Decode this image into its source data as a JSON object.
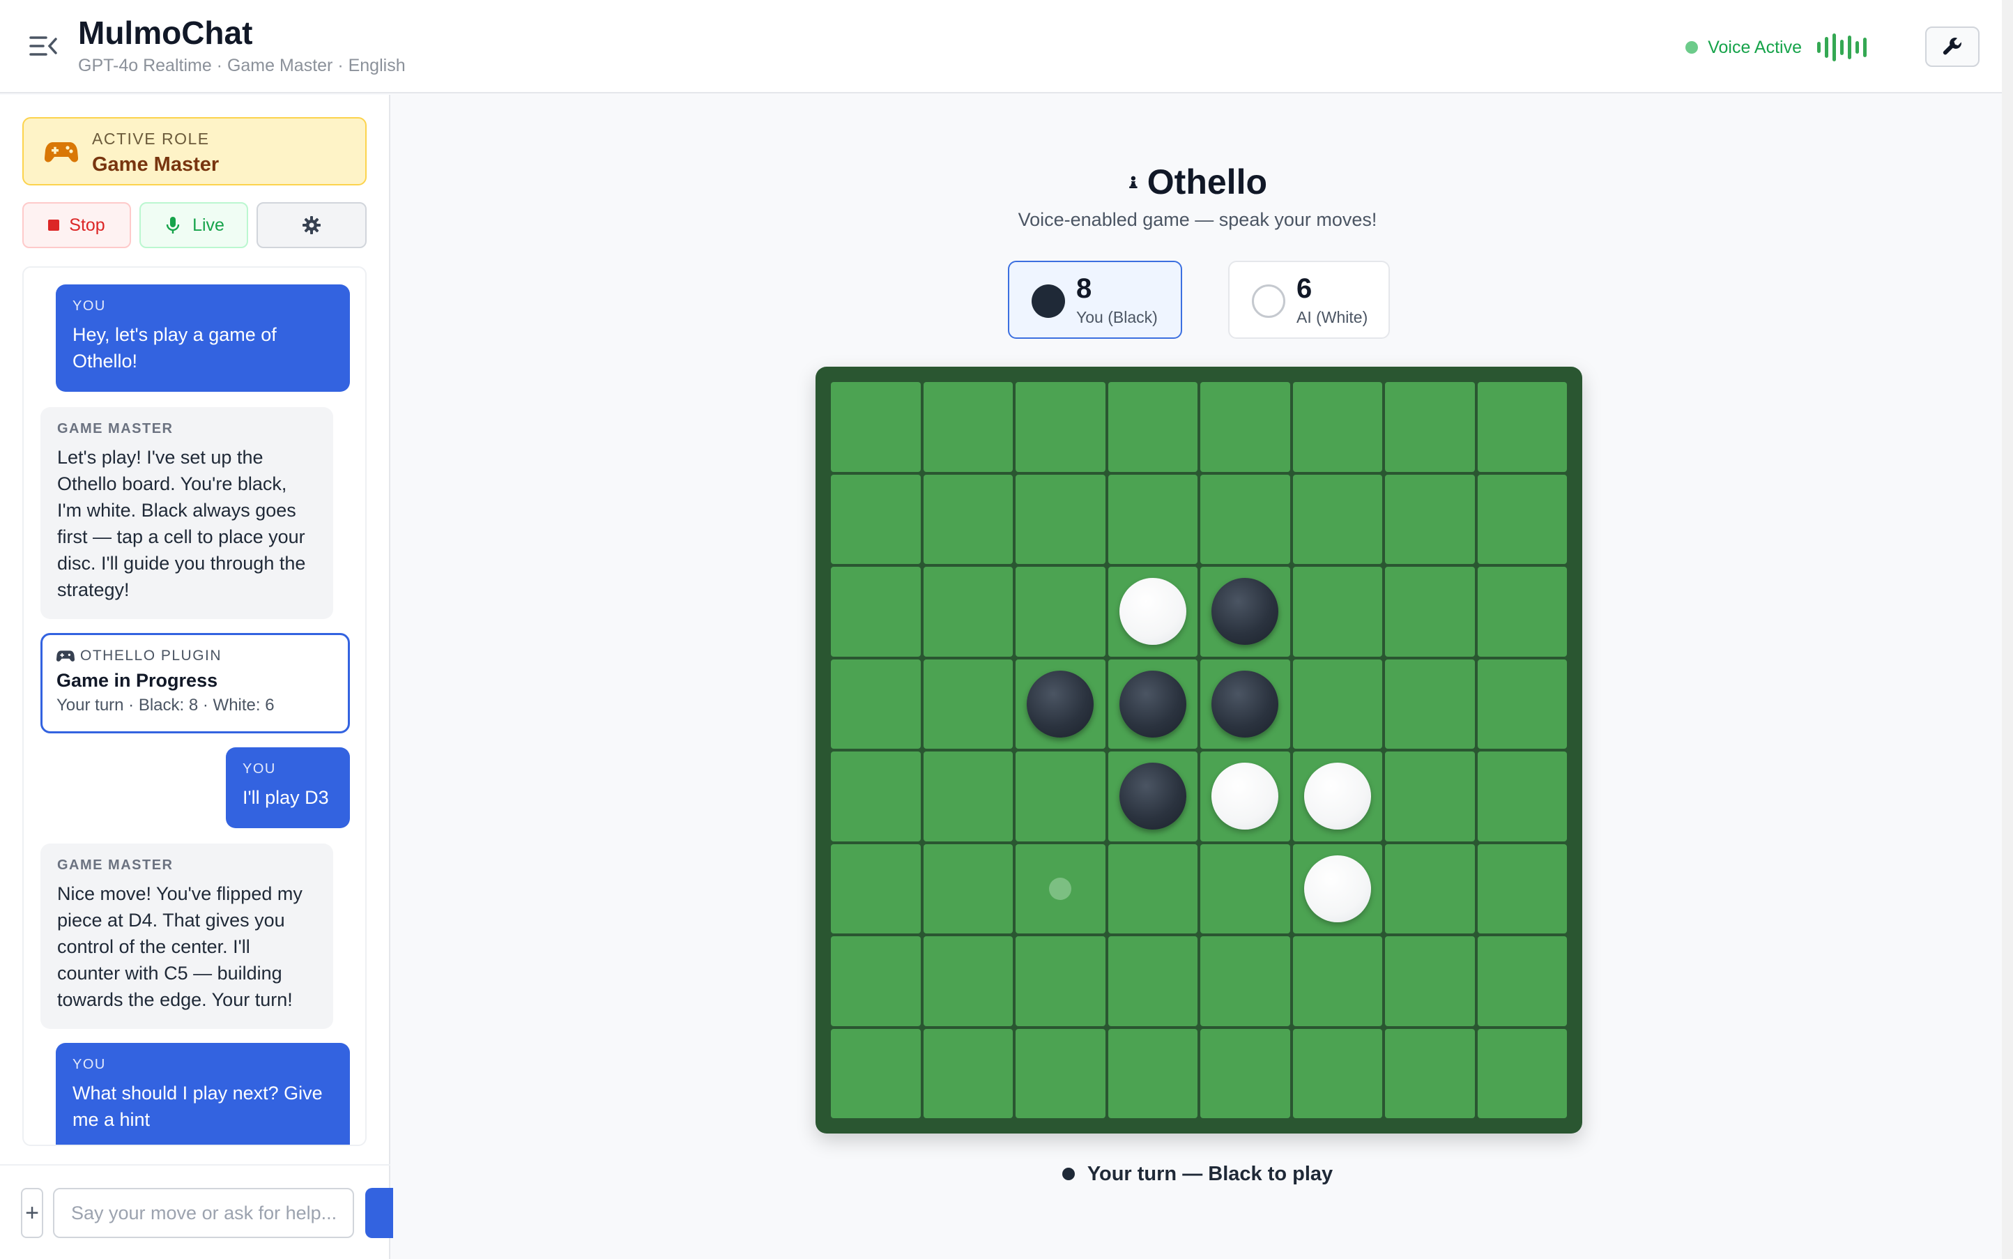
{
  "header": {
    "title": "MulmoChat",
    "subtitle": "GPT-4o Realtime · Game Master · English",
    "voice_status": "Voice Active"
  },
  "sidebar": {
    "role_label": "ACTIVE ROLE",
    "role_name": "Game Master",
    "stop_label": "Stop",
    "live_label": "Live",
    "messages": [
      {
        "role": "user",
        "who": "YOU",
        "text": "Hey, let's play a game of Othello!"
      },
      {
        "role": "assistant",
        "who": "GAME MASTER",
        "text": "Let's play! I've set up the Othello board. You're black, I'm white. Black always goes first — tap a cell to place your disc. I'll guide you through the strategy!"
      },
      {
        "role": "plugin",
        "who": "OTHELLO PLUGIN",
        "title": "Game in Progress",
        "status": "Your turn · Black: 8 · White: 6"
      },
      {
        "role": "user",
        "who": "YOU",
        "text": "I'll play D3"
      },
      {
        "role": "assistant",
        "who": "GAME MASTER",
        "text": "Nice move! You've flipped my piece at D4. That gives you control of the center. I'll counter with C5 — building towards the edge. Your turn!"
      },
      {
        "role": "user",
        "who": "YOU",
        "text": "What should I play next? Give me a hint"
      }
    ],
    "input_placeholder": "Say your move or ask for help...",
    "plus_label": "+"
  },
  "game": {
    "title": "Othello",
    "subtitle": "Voice-enabled game — speak your moves!",
    "score_you": {
      "count": "8",
      "label": "You (Black)"
    },
    "score_ai": {
      "count": "6",
      "label": "AI (White)"
    },
    "board": [
      "........",
      "........",
      "...WB...",
      "..BBB...",
      "...BWW..",
      "..h..W..",
      "........",
      "........"
    ],
    "turn_text": "Your turn — Black to play"
  },
  "colors": {
    "accent": "#3363e0",
    "board_border": "#2a5631",
    "cell": "#4ca352",
    "voice": "#16a34a"
  }
}
